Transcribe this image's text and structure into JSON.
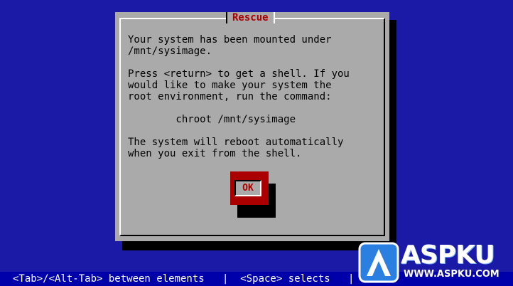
{
  "dialog": {
    "title": "Rescue",
    "message": "Your system has been mounted under\n/mnt/sysimage.\n\nPress <return> to get a shell. If you\nwould like to make your system the\nroot environment, run the command:\n\n        chroot /mnt/sysimage\n\nThe system will reboot automatically\nwhen you exit from the shell.",
    "ok_label": "OK"
  },
  "status_bar": {
    "text": "<Tab>/<Alt-Tab> between elements   |  <Space> selects   |"
  },
  "watermark": {
    "brand": "ASPKU",
    "url": "WWW.ASPKU.COM",
    "logo_icon": "aspku-logo-icon"
  },
  "colors": {
    "background": "#0000aa",
    "dialog": "#aaaaaa",
    "title": "#aa0000",
    "button": "#aa0000",
    "status_text": "#ffffff"
  }
}
